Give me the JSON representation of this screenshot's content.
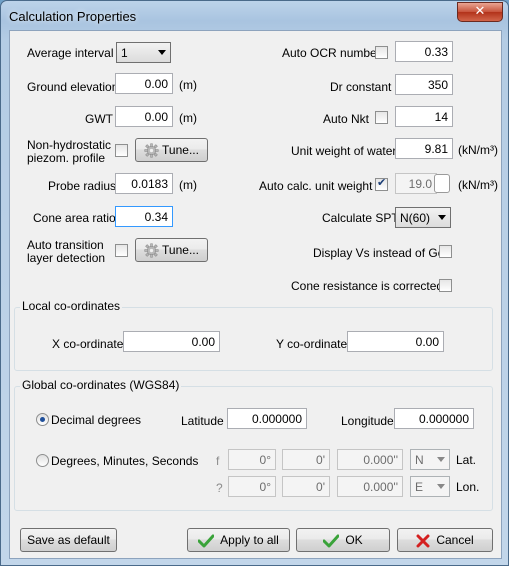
{
  "window": {
    "title": "Calculation Properties",
    "close_glyph": "✕"
  },
  "left": {
    "average_interval_label": "Average interval",
    "average_interval_value": "1",
    "ground_elevation_label": "Ground elevation",
    "ground_elevation_value": "0.00",
    "ground_elevation_unit": "(m)",
    "gwt_label": "GWT",
    "gwt_value": "0.00",
    "gwt_unit": "(m)",
    "nonhydro_label_1": "Non-hydrostatic",
    "nonhydro_label_2": "piezom. profile",
    "tune_label": "Tune...",
    "probe_radius_label": "Probe radius",
    "probe_radius_value": "0.0183",
    "probe_radius_unit": "(m)",
    "cone_area_label": "Cone area ratio",
    "cone_area_value": "0.34",
    "auto_transition_label_1": "Auto transition",
    "auto_transition_label_2": "layer detection",
    "tune2_label": "Tune..."
  },
  "right": {
    "auto_ocr_label": "Auto OCR number",
    "auto_ocr_value": "0.33",
    "dr_constant_label": "Dr constant",
    "dr_constant_value": "350",
    "auto_nkt_label": "Auto Nkt",
    "auto_nkt_value": "14",
    "unit_weight_water_label": "Unit weight of water",
    "unit_weight_water_value": "9.81",
    "unit_weight_water_unit": "(kN/m³)",
    "auto_calc_label": "Auto calc. unit weight",
    "auto_calc_value": "19.0",
    "auto_calc_unit": "(kN/m³)",
    "calculate_spt_label": "Calculate SPT",
    "calculate_spt_value": "N(60)",
    "display_vs_label": "Display Vs instead of Go",
    "cone_corrected_label": "Cone resistance is corrected"
  },
  "local": {
    "title": "Local co-ordinates",
    "x_label": "X co-ordinate",
    "x_value": "0.00",
    "y_label": "Y co-ordinate",
    "y_value": "0.00"
  },
  "global": {
    "title": "Global co-ordinates (WGS84)",
    "decimal_label": "Decimal degrees",
    "latitude_label": "Latitude",
    "latitude_value": "0.000000",
    "longitude_label": "Longitude",
    "longitude_value": "0.000000",
    "dms_label": "Degrees, Minutes, Seconds",
    "lat_glyph": "f",
    "lat_deg": "0°",
    "lat_min": "0'",
    "lat_sec": "0.000''",
    "lat_dir": "N",
    "lat_label": "Lat.",
    "lon_glyph": "?",
    "lon_deg": "0°",
    "lon_min": "0'",
    "lon_sec": "0.000''",
    "lon_dir": "E",
    "lon_label": "Lon."
  },
  "buttons": {
    "save_default": "Save as default",
    "apply_all": "Apply to all",
    "ok": "OK",
    "cancel": "Cancel"
  },
  "colors": {
    "check_green": "#3aa33a",
    "cancel_red": "#d42020"
  }
}
